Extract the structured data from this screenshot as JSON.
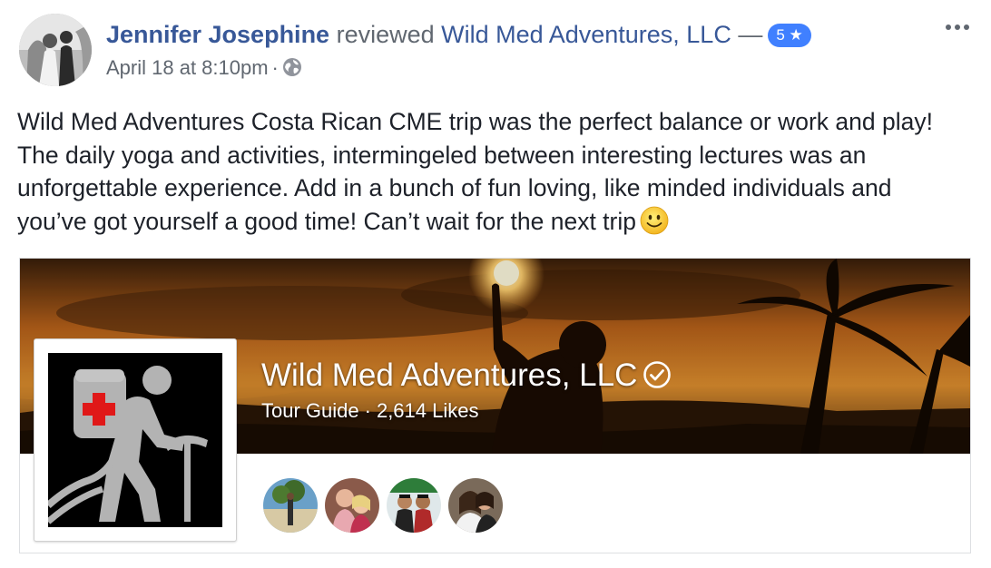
{
  "post": {
    "author": "Jennifer Josephine",
    "verb": "reviewed",
    "page_name": "Wild Med Adventures, LLC",
    "dash": "—",
    "rating": "5",
    "timestamp": "April 18 at 8:10pm",
    "separator": "·",
    "privacy_icon": "globe-icon",
    "more_icon": "more-options-icon",
    "review_text": "Wild Med Adventures Costa Rican CME trip was the perfect balance or work and play! The daily yoga and activities, intermingeled between interesting lectures was an unforgettable experience. Add in a bunch of fun loving, like minded individuals and you’ve got yourself a good time! Can’t wait for the next trip",
    "emoji_icon": "smiley-emoji-icon"
  },
  "attachment": {
    "page_title": "Wild Med Adventures, LLC",
    "category": "Tour Guide",
    "likes": "2,614 Likes",
    "separator": "·",
    "verified_icon": "verified-check-icon",
    "logo_icon": "hiker-medical-backpack-icon"
  },
  "colors": {
    "link": "#385898",
    "secondary": "#606770",
    "badge": "#4080ff",
    "text": "#1d2129",
    "border": "#dddfe2"
  }
}
